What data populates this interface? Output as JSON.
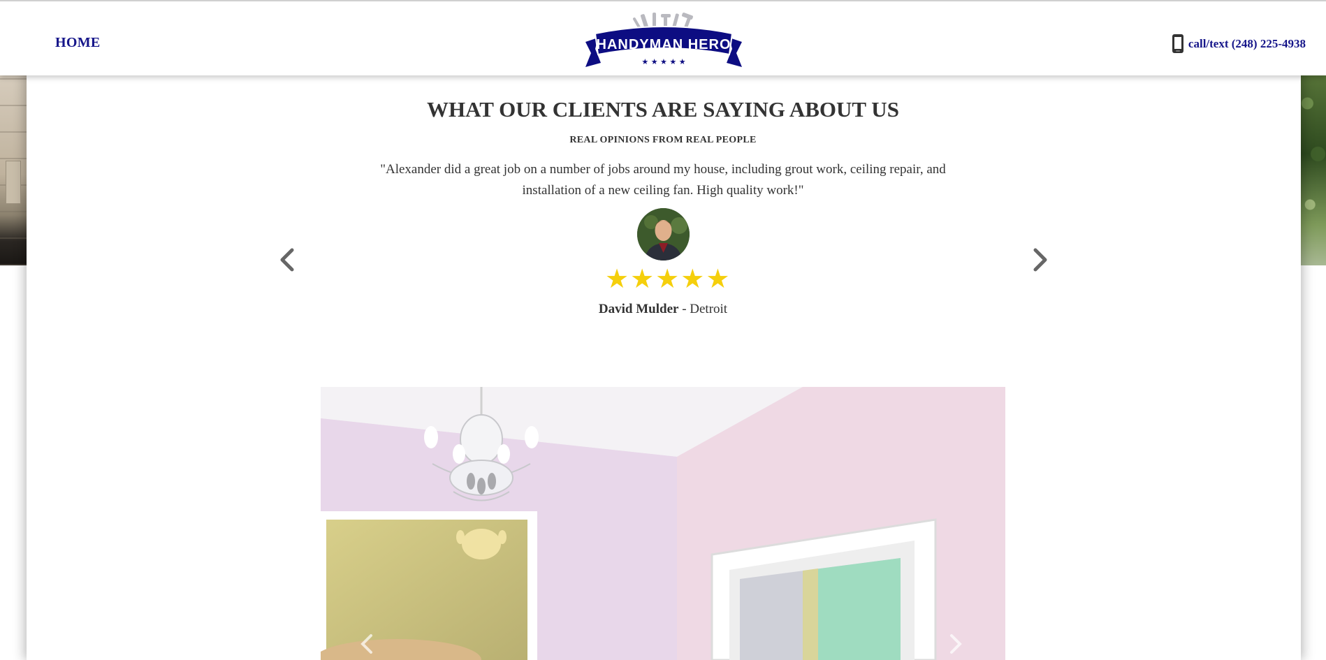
{
  "header": {
    "nav_home": "HOME",
    "logo_text": "HANDYMAN HERO",
    "phone_text": "call/text (248) 225-4938"
  },
  "testimonials": {
    "heading": "WHAT OUR CLIENTS ARE SAYING ABOUT US",
    "subheading": "REAL OPINIONS FROM REAL PEOPLE",
    "quote": "\"Alexander did a great job on a number of jobs around my house, including grout work, ceiling repair, and installation of a new ceiling fan. High quality work!\"",
    "rating": 5,
    "author_name": "David Mulder",
    "author_location": " - Detroit"
  },
  "colors": {
    "nav_blue": "#16168a",
    "star_yellow": "#f5cf0c",
    "text_dark": "#333333"
  },
  "icons": {
    "phone": "mobile-phone-icon",
    "prev": "chevron-left-icon",
    "next": "chevron-right-icon"
  }
}
